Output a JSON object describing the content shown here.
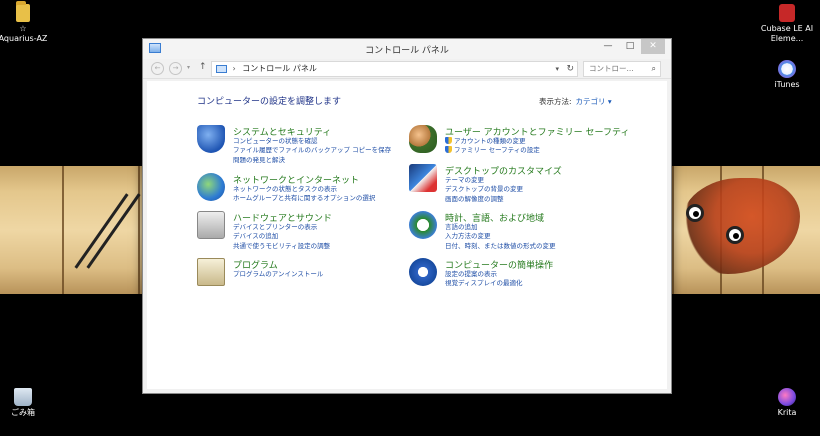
{
  "desktop": {
    "icons": [
      {
        "label": "Aquarius-AZ",
        "sublabel": "☆",
        "icon": "folder-icon"
      },
      {
        "label": "Cubase LE AI Eleme...",
        "icon": "cubase-icon"
      },
      {
        "label": "iTunes",
        "icon": "itunes-icon"
      },
      {
        "label": "ごみ箱",
        "icon": "recycle-bin-icon"
      },
      {
        "label": "Krita",
        "icon": "krita-icon"
      }
    ]
  },
  "window": {
    "title": "コントロール パネル",
    "buttons": {
      "minimize": "—",
      "maximize": "□",
      "close": "✕"
    },
    "address": {
      "back": "←",
      "forward": "→",
      "dropdown": "▾",
      "up": "↑",
      "separator": "›",
      "path": "コントロール パネル",
      "refresh": "↻",
      "search_placeholder": "コントロー...",
      "search_icon": "⌕"
    },
    "heading": "コンピューターの設定を調整します",
    "view_by": {
      "label": "表示方法:",
      "value": "カテゴリ ▾"
    },
    "categories": [
      {
        "title": "システムとセキュリティ",
        "icon": "shield-icon",
        "links": [
          "コンピューターの状態を確認",
          "ファイル履歴でファイルのバックアップ コピーを保存",
          "問題の発見と解決"
        ]
      },
      {
        "title": "ネットワークとインターネット",
        "icon": "network-globe-icon",
        "links": [
          "ネットワークの状態とタスクの表示",
          "ホームグループと共有に関するオプションの選択"
        ]
      },
      {
        "title": "ハードウェアとサウンド",
        "icon": "printer-icon",
        "links": [
          "デバイスとプリンターの表示",
          "デバイスの追加",
          "共通で使うモビリティ設定の調整"
        ]
      },
      {
        "title": "プログラム",
        "icon": "programs-icon",
        "links": [
          "プログラムのアンインストール"
        ]
      },
      {
        "title": "ユーザー アカウントとファミリー セーフティ",
        "icon": "users-icon",
        "links": [
          "アカウントの種類の変更",
          "ファミリー セーフティの設定"
        ],
        "shielded_links": [
          true,
          true
        ]
      },
      {
        "title": "デスクトップのカスタマイズ",
        "icon": "appearance-icon",
        "links": [
          "テーマの変更",
          "デスクトップの背景の変更",
          "画面の解像度の調整"
        ]
      },
      {
        "title": "時計、言語、および地域",
        "icon": "clock-globe-icon",
        "links": [
          "言語の追加",
          "入力方法の変更",
          "日付、時刻、または数値の形式の変更"
        ]
      },
      {
        "title": "コンピューターの簡単操作",
        "icon": "ease-of-access-icon",
        "links": [
          "設定の提案の表示",
          "視覚ディスプレイの最適化"
        ]
      }
    ]
  },
  "colors": {
    "heading": "#1e3287",
    "category_title": "#257a1d",
    "link": "#1f4ea6"
  }
}
